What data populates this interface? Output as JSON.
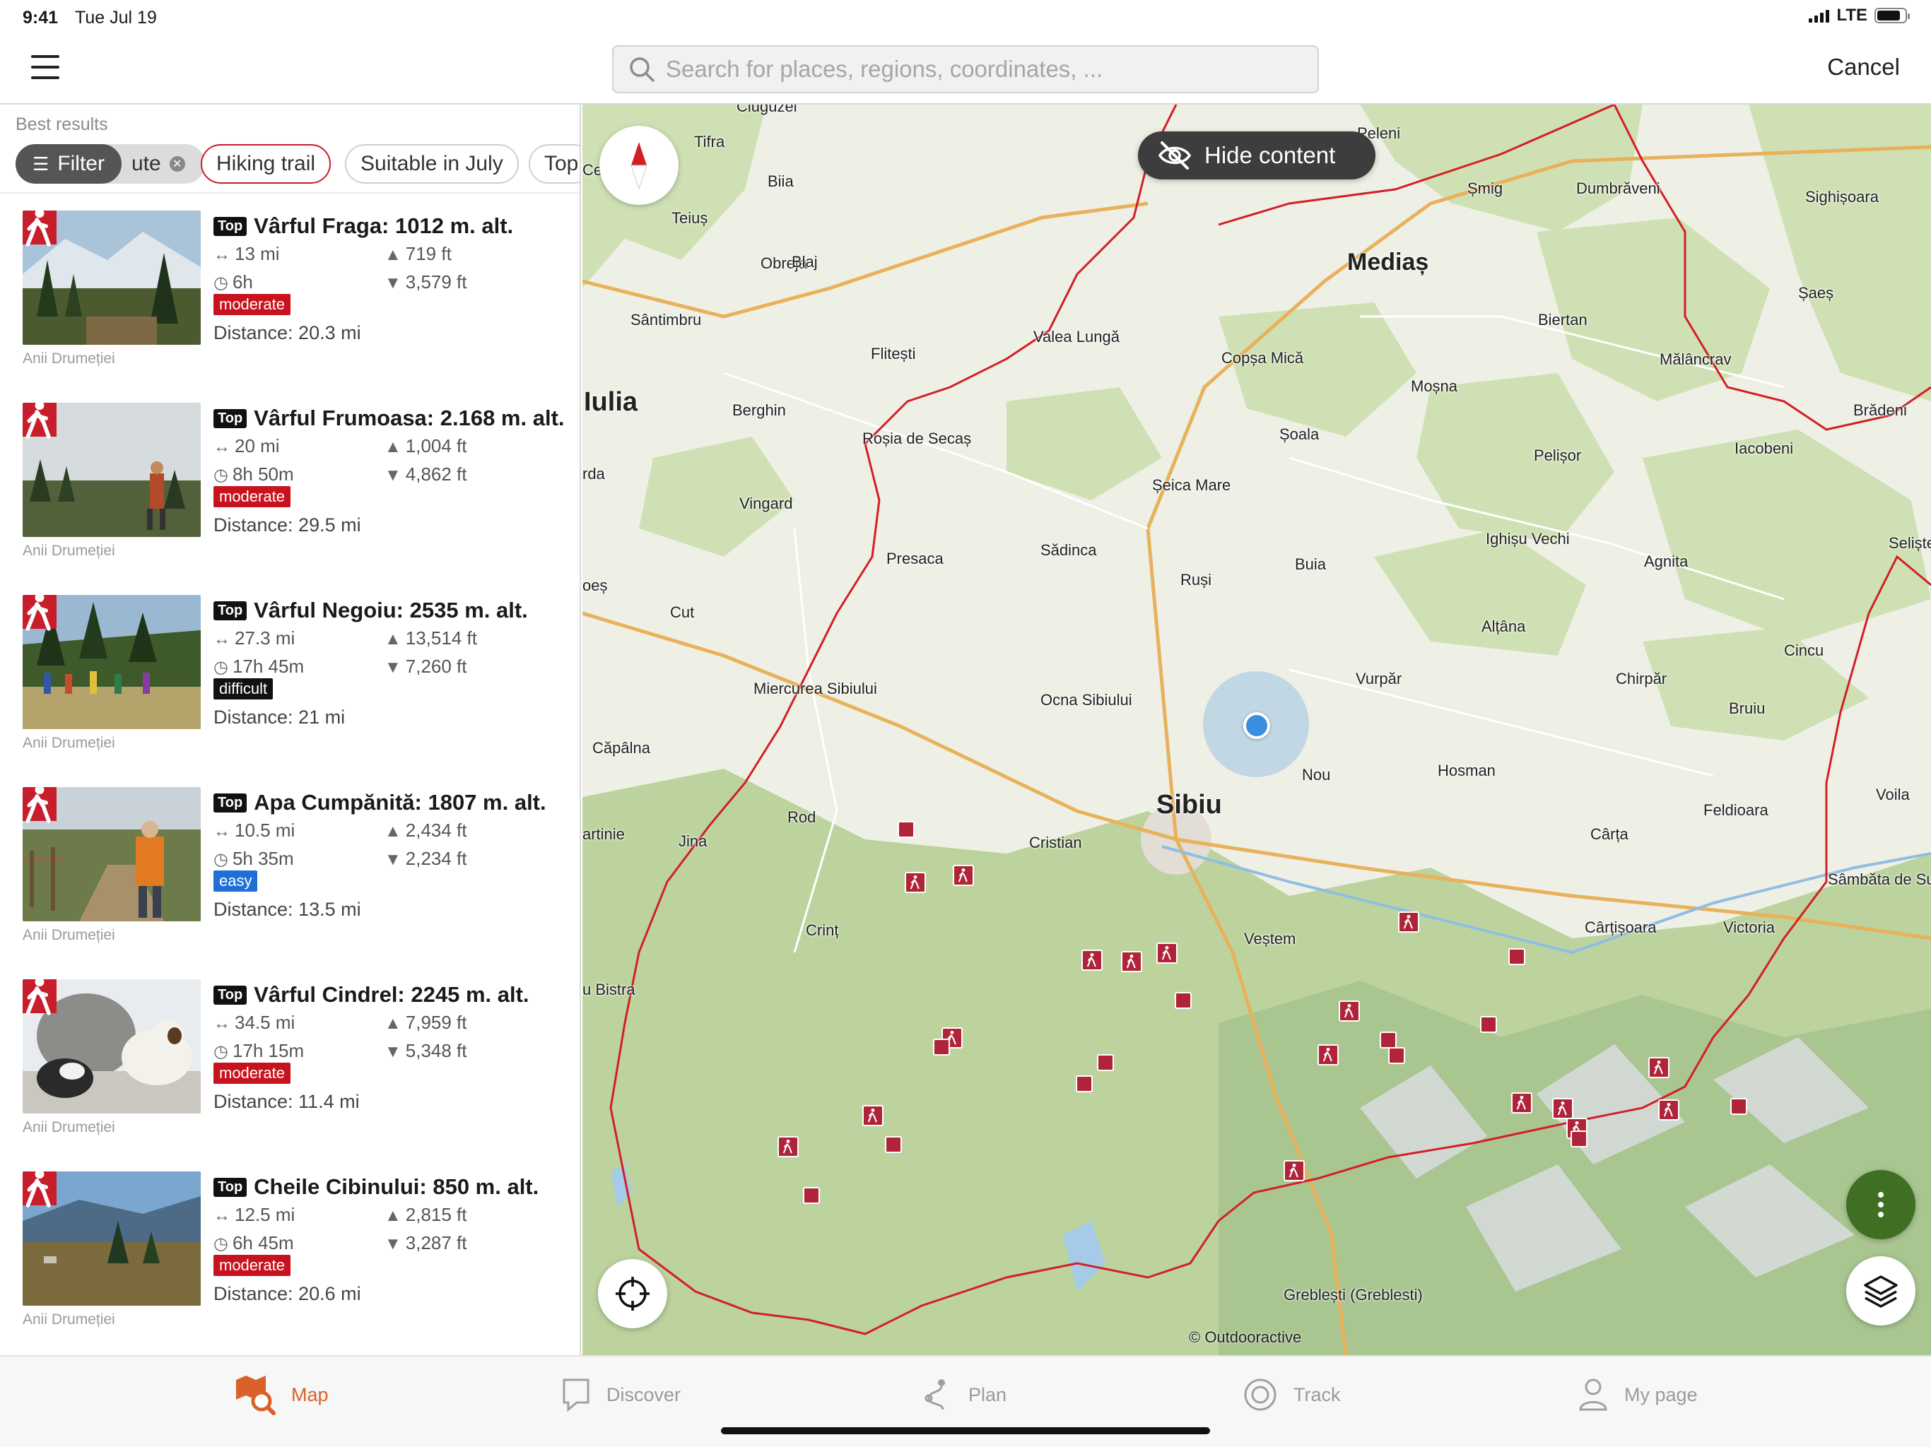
{
  "status_bar": {
    "time": "9:41",
    "date": "Tue Jul 19",
    "network": "LTE"
  },
  "navbar": {
    "search_placeholder": "Search for places, regions, coordinates, ...",
    "cancel_label": "Cancel"
  },
  "results": {
    "heading": "Best results",
    "filter_label": "Filter",
    "chips": [
      "ute",
      "Hiking trail",
      "Suitable in July",
      "Top"
    ],
    "items": [
      {
        "top": "Top",
        "title": "Vârful Fraga: 1012 m. alt.",
        "distance_len": "13 mi",
        "ascent": "719 ft",
        "duration": "6h",
        "descent": "3,579 ft",
        "difficulty": "moderate",
        "distance": "Distance: 20.3 mi",
        "credit": "Anii Drumeției"
      },
      {
        "top": "Top",
        "title": "Vârful Frumoasa: 2.168 m. alt.",
        "distance_len": "20 mi",
        "ascent": "1,004 ft",
        "duration": "8h 50m",
        "descent": "4,862 ft",
        "difficulty": "moderate",
        "distance": "Distance: 29.5 mi",
        "credit": "Anii Drumeției"
      },
      {
        "top": "Top",
        "title": "Vârful Negoiu: 2535 m. alt.",
        "distance_len": "27.3 mi",
        "ascent": "13,514 ft",
        "duration": "17h 45m",
        "descent": "7,260 ft",
        "difficulty": "difficult",
        "distance": "Distance: 21 mi",
        "credit": "Anii Drumeției"
      },
      {
        "top": "Top",
        "title": "Apa Cumpănită: 1807 m. alt.",
        "distance_len": "10.5 mi",
        "ascent": "2,434 ft",
        "duration": "5h 35m",
        "descent": "2,234 ft",
        "difficulty": "easy",
        "distance": "Distance: 13.5 mi",
        "credit": "Anii Drumeției"
      },
      {
        "top": "Top",
        "title": "Vârful Cindrel: 2245 m. alt.",
        "distance_len": "34.5 mi",
        "ascent": "7,959 ft",
        "duration": "17h 15m",
        "descent": "5,348 ft",
        "difficulty": "moderate",
        "distance": "Distance: 11.4 mi",
        "credit": "Anii Drumeției"
      },
      {
        "top": "Top",
        "title": "Cheile Cibinului: 850 m. alt.",
        "distance_len": "12.5 mi",
        "ascent": "2,815 ft",
        "duration": "6h 45m",
        "descent": "3,287 ft",
        "difficulty": "moderate",
        "distance": "Distance: 20.6 mi",
        "credit": "Anii Drumeției"
      }
    ]
  },
  "map": {
    "hide_content_label": "Hide content",
    "attribution": "© Outdooractive",
    "labels": {
      "tifra": "Tifra",
      "ciuguzel": "Ciuguzel",
      "teius": "Teiuș",
      "biia": "Biia",
      "obreja": "Obreja",
      "blaj": "Blaj",
      "santimbru": "Sântimbru",
      "valea_lunga": "Valea Lungă",
      "flitesti": "Flitești",
      "iulia": "Iulia",
      "berghin": "Berghin",
      "rosia": "Roșia de Secaș",
      "rda": "rda",
      "vingard": "Vingard",
      "presaca": "Presaca",
      "sadinca": "Sădinca",
      "oes": "oeș",
      "cut": "Cut",
      "miercurea": "Miercurea Sibiului",
      "ocna": "Ocna Sibiului",
      "capalna": "Căpâlna",
      "rod": "Rod",
      "jina": "Jina",
      "artinie": "artinie",
      "cristian": "Cristian",
      "sibiu": "Sibiu",
      "crint": "Crinț",
      "bistra": "u Bistra",
      "vestem": "Veștem",
      "rusi": "Ruși",
      "buia": "Buia",
      "seica": "Șeica Mare",
      "soala": "Șoala",
      "copsa": "Copșa Mică",
      "medias": "Mediaș",
      "smig": "Șmig",
      "pelei": "Peleni",
      "dumbraveni": "Dumbrăveni",
      "sighisoara": "Sighișoara",
      "saes": "Șaeș",
      "biertan": "Biertan",
      "malancrav": "Mălâncrav",
      "mosna": "Moșna",
      "bradeni": "Brădeni",
      "iacobeni": "Iacobeni",
      "pelisor": "Pelișor",
      "ighisu": "Ighișu Vechi",
      "agnita": "Agnita",
      "selista": "Seliștea",
      "altana": "Alțâna",
      "vurpar": "Vurpăr",
      "chirpar": "Chirpăr",
      "cincu": "Cincu",
      "bruiu": "Bruiu",
      "nou": "Nou",
      "hosman": "Hosman",
      "feldioara": "Feldioara",
      "voila": "Voila",
      "carta": "Cârța",
      "sambata": "Sâmbăta de Sus",
      "cartisoara": "Cârțișoara",
      "victoria": "Victoria",
      "greblesti": "Greblești (Greblesti)",
      "ceta": "Ceta"
    }
  },
  "tabbar": {
    "tabs": [
      "Map",
      "Discover",
      "Plan",
      "Track",
      "My page"
    ],
    "active": "Map"
  },
  "colors": {
    "accent": "#d9622a",
    "trail_red": "#c81d2a",
    "poi": "#b0243a",
    "more_button": "#3f6f22"
  }
}
